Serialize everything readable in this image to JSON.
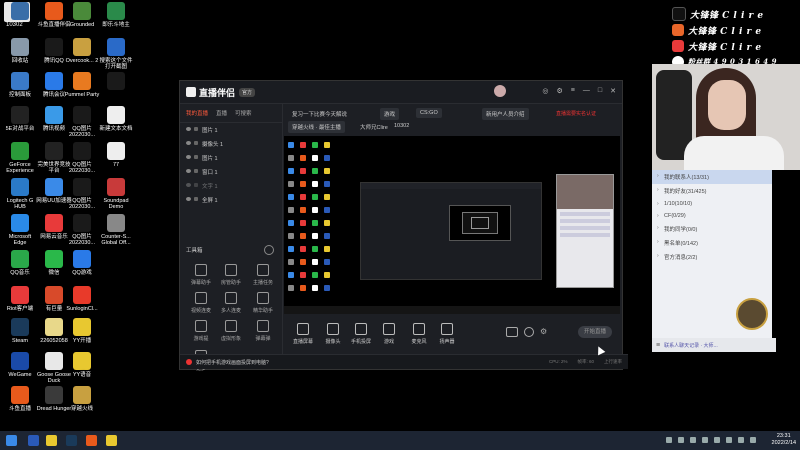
{
  "overlay": {
    "stream_id": "10302"
  },
  "desktop": {
    "icons": [
      {
        "label": "",
        "color": "#3a6ea8"
      },
      {
        "label": "斗鱼直播伴侣",
        "color": "#e85a1c"
      },
      {
        "label": "Grounded",
        "color": "#4a8a3a"
      },
      {
        "label": "即乐斗地主",
        "color": "#2a8a4a"
      },
      {
        "label": "回收站",
        "color": "#8899aa"
      },
      {
        "label": "腾讯QQ",
        "color": "#1a1a1a"
      },
      {
        "label": "Overcook... 2",
        "color": "#c9a040"
      },
      {
        "label": "搜索这个文件打开截图",
        "color": "#2a6ac8"
      },
      {
        "label": "控制面板",
        "color": "#3a7ac8"
      },
      {
        "label": "腾讯会议",
        "color": "#2a7ae8"
      },
      {
        "label": "Pummel Party",
        "color": "#e87a20"
      },
      {
        "label": "",
        "color": "#1a1a1a"
      },
      {
        "label": "5E对战平台",
        "color": "#222222"
      },
      {
        "label": "腾讯视频",
        "color": "#3a9ae8"
      },
      {
        "label": "QQ图片 2022030...",
        "color": "#1a1a1a"
      },
      {
        "label": "新建文本文档",
        "color": "#eeeeee"
      },
      {
        "label": "GeForce Experience",
        "color": "#2a9a3a"
      },
      {
        "label": "完美世界竞技平台",
        "color": "#222222"
      },
      {
        "label": "QQ图片 2022030...",
        "color": "#1a1a1a"
      },
      {
        "label": "77",
        "color": "#eeeeee"
      },
      {
        "label": "Logitech G HUB",
        "color": "#2a7ac8"
      },
      {
        "label": "网易UU加速器",
        "color": "#3a8ae8"
      },
      {
        "label": "QQ图片 2022030...",
        "color": "#1a1a1a"
      },
      {
        "label": "Soundpad Demo",
        "color": "#c83a3a"
      },
      {
        "label": "Microsoft Edge",
        "color": "#2a8ae8"
      },
      {
        "label": "网易云音乐",
        "color": "#e83a3a"
      },
      {
        "label": "QQ图片 2022030...",
        "color": "#1a1a1a"
      },
      {
        "label": "Counter-S... Global Off...",
        "color": "#888888"
      },
      {
        "label": "QQ音乐",
        "color": "#2aa84a"
      },
      {
        "label": "微信",
        "color": "#2ab84a"
      },
      {
        "label": "QQ游戏",
        "color": "#2a7ae8"
      },
      {
        "label": "",
        "color": "#000000"
      },
      {
        "label": "Riot客户端",
        "color": "#e83a3a"
      },
      {
        "label": "有巨量",
        "color": "#d84a2a"
      },
      {
        "label": "SunloginCl...",
        "color": "#e83a2a"
      },
      {
        "label": "",
        "color": "#000000"
      },
      {
        "label": "Steam",
        "color": "#1a3a5a"
      },
      {
        "label": "226052058",
        "color": "#e8d88a"
      },
      {
        "label": "YY开播",
        "color": "#e8c830"
      },
      {
        "label": "",
        "color": "#000000"
      },
      {
        "label": "WeGame",
        "color": "#1a4aa8"
      },
      {
        "label": "Goose Goose Duck",
        "color": "#e8e8e8"
      },
      {
        "label": "YY语音",
        "color": "#e8c830"
      },
      {
        "label": "",
        "color": "#000000"
      },
      {
        "label": "斗鱼直播",
        "color": "#e85a1c"
      },
      {
        "label": "Dread Hunger",
        "color": "#3a3a3a"
      },
      {
        "label": "穿越火线",
        "color": "#c8a040"
      }
    ]
  },
  "app": {
    "logo_text": "直播伴侣",
    "version_badge": "官方",
    "left_tabs": [
      "我的直播",
      "直播",
      "可搜索"
    ],
    "sources": [
      {
        "label": "图片 1"
      },
      {
        "label": "摄像头 1"
      },
      {
        "label": "图片 1"
      },
      {
        "label": "窗口 1"
      },
      {
        "label": "文字 1"
      },
      {
        "label": "全屏 1"
      }
    ],
    "tools_header": "工具箱",
    "tools": [
      {
        "label": "弹幕助手"
      },
      {
        "label": "房管助手"
      },
      {
        "label": "主播任务"
      },
      {
        "label": "视频连麦"
      },
      {
        "label": "多人连麦"
      },
      {
        "label": "精华助手"
      },
      {
        "label": "游戏提"
      },
      {
        "label": "虚拟形象"
      },
      {
        "label": "弹幕弹"
      },
      {
        "label": "更多"
      }
    ],
    "scene_title": "复习一下比赛今天解说",
    "scene_tags": [
      "游戏",
      "CS:GO"
    ],
    "tag_account": "新用户人员介绍",
    "tag_red": "直播需要实名认证",
    "second_row": [
      "穿越火线 · 最佳主播",
      "大师兄Clire",
      "10302"
    ],
    "bottom_tools": [
      {
        "label": "直播屏幕"
      },
      {
        "label": "摄像头"
      },
      {
        "label": "手机投屏"
      },
      {
        "label": "游戏"
      },
      {
        "label": "麦克风"
      },
      {
        "label": "扬声器"
      }
    ],
    "live_button": "开始直播",
    "status_text": "如何把手机游戏画面投屏到电脑?",
    "status_right": [
      "CPU: 2%",
      "帧率: 60",
      "上行速率"
    ]
  },
  "social": {
    "lines": [
      "大锋锋 C l i r e",
      "大锋锋 C l i r e",
      "大锋锋 C l i r e",
      "粉丝群 4 9 0 3 1 6 4 9"
    ],
    "icon_colors": [
      "#111111",
      "#e8662a",
      "#e83a3a",
      "#ffffff"
    ]
  },
  "qq": {
    "items": [
      {
        "label": "我的联系人(13/31)",
        "selected": true
      },
      {
        "label": "我的好友(31/425)",
        "selected": false
      },
      {
        "label": "1/10(10/10)",
        "selected": false
      },
      {
        "label": "CF(0/29)",
        "selected": false
      },
      {
        "label": "我的同学(0/0)",
        "selected": false
      },
      {
        "label": "黑名单(0/142)",
        "selected": false
      },
      {
        "label": "官方消息(2/2)",
        "selected": false
      }
    ],
    "bottom_text": "联系人聊天记录 · 大师..."
  },
  "taskbar": {
    "time": "23:31",
    "date": "2022/2/14"
  }
}
